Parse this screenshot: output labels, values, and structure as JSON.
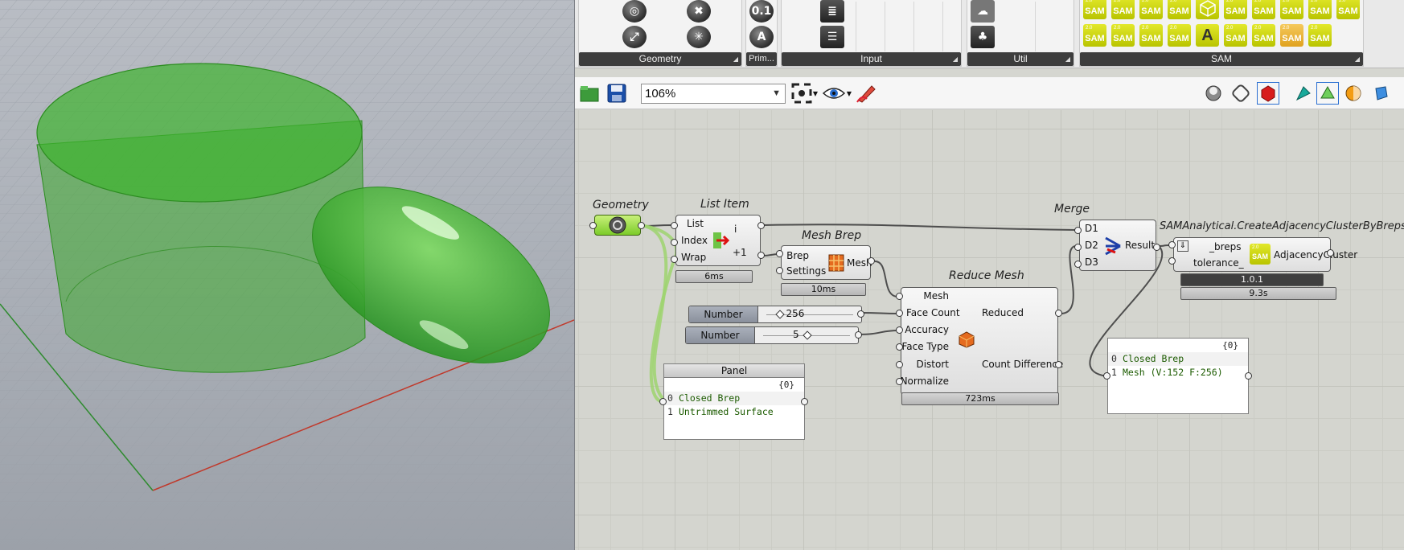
{
  "ribbon": {
    "groups": [
      {
        "name": "Geometry"
      },
      {
        "name": "Prim..."
      },
      {
        "name": "Input"
      },
      {
        "name": "Util"
      },
      {
        "name": "SAM"
      }
    ],
    "sam_icon_label": "SAM",
    "prim_icons": [
      "0.1",
      "A"
    ],
    "sam_letter_icon": "A"
  },
  "toolbar": {
    "zoom": "106%"
  },
  "nodes": {
    "geometry": {
      "title": "Geometry"
    },
    "list_item": {
      "title": "List Item",
      "inputs": [
        "List",
        "Index",
        "Wrap"
      ],
      "outputs": [
        "i",
        "+1"
      ],
      "time": "6ms"
    },
    "mesh_brep": {
      "title": "Mesh Brep",
      "inputs": [
        "Brep",
        "Settings"
      ],
      "output": "Mesh",
      "time": "10ms"
    },
    "reduce_mesh": {
      "title": "Reduce Mesh",
      "inputs": [
        "Mesh",
        "Face Count",
        "Accuracy",
        "Face Type",
        "Distort",
        "Normalize"
      ],
      "outputs": [
        "Reduced",
        "Count Difference"
      ],
      "time": "723ms"
    },
    "merge": {
      "title": "Merge",
      "inputs": [
        "D1",
        "D2",
        "D3"
      ],
      "output": "Result"
    },
    "create_cluster": {
      "title": "SAMAnalytical.CreateAdjacencyClusterByBreps",
      "inputs": [
        "_breps",
        "tolerance_"
      ],
      "output": "AdjacencyCluster",
      "version": "1.0.1",
      "time": "9.3s"
    }
  },
  "sliders": [
    {
      "name": "Number Slider",
      "value": "256",
      "fraction": 0.15
    },
    {
      "name": "Number Slider",
      "value": "5",
      "fraction": 0.5
    }
  ],
  "panel1": {
    "title": "Panel",
    "path": "{0}",
    "rows": [
      {
        "index": "0",
        "text": "Closed Brep"
      },
      {
        "index": "1",
        "text": "Untrimmed Surface"
      }
    ]
  },
  "panel2": {
    "path": "{0}",
    "rows": [
      {
        "index": "0",
        "text": "Closed Brep"
      },
      {
        "index": "1",
        "text": "Mesh (V:152  F:256)"
      }
    ]
  },
  "colors": {
    "shape_green": "#3daa2c",
    "sam_yellow": "#c8d400",
    "axis_red": "#c0392b",
    "axis_green": "#2e8b2e",
    "canvas": "#d4d5cf"
  },
  "icons": [
    "open-file-icon",
    "save-icon",
    "zoom-extents-icon",
    "preview-eye-icon",
    "sketch-pen-icon",
    "display-mode-icons"
  ]
}
